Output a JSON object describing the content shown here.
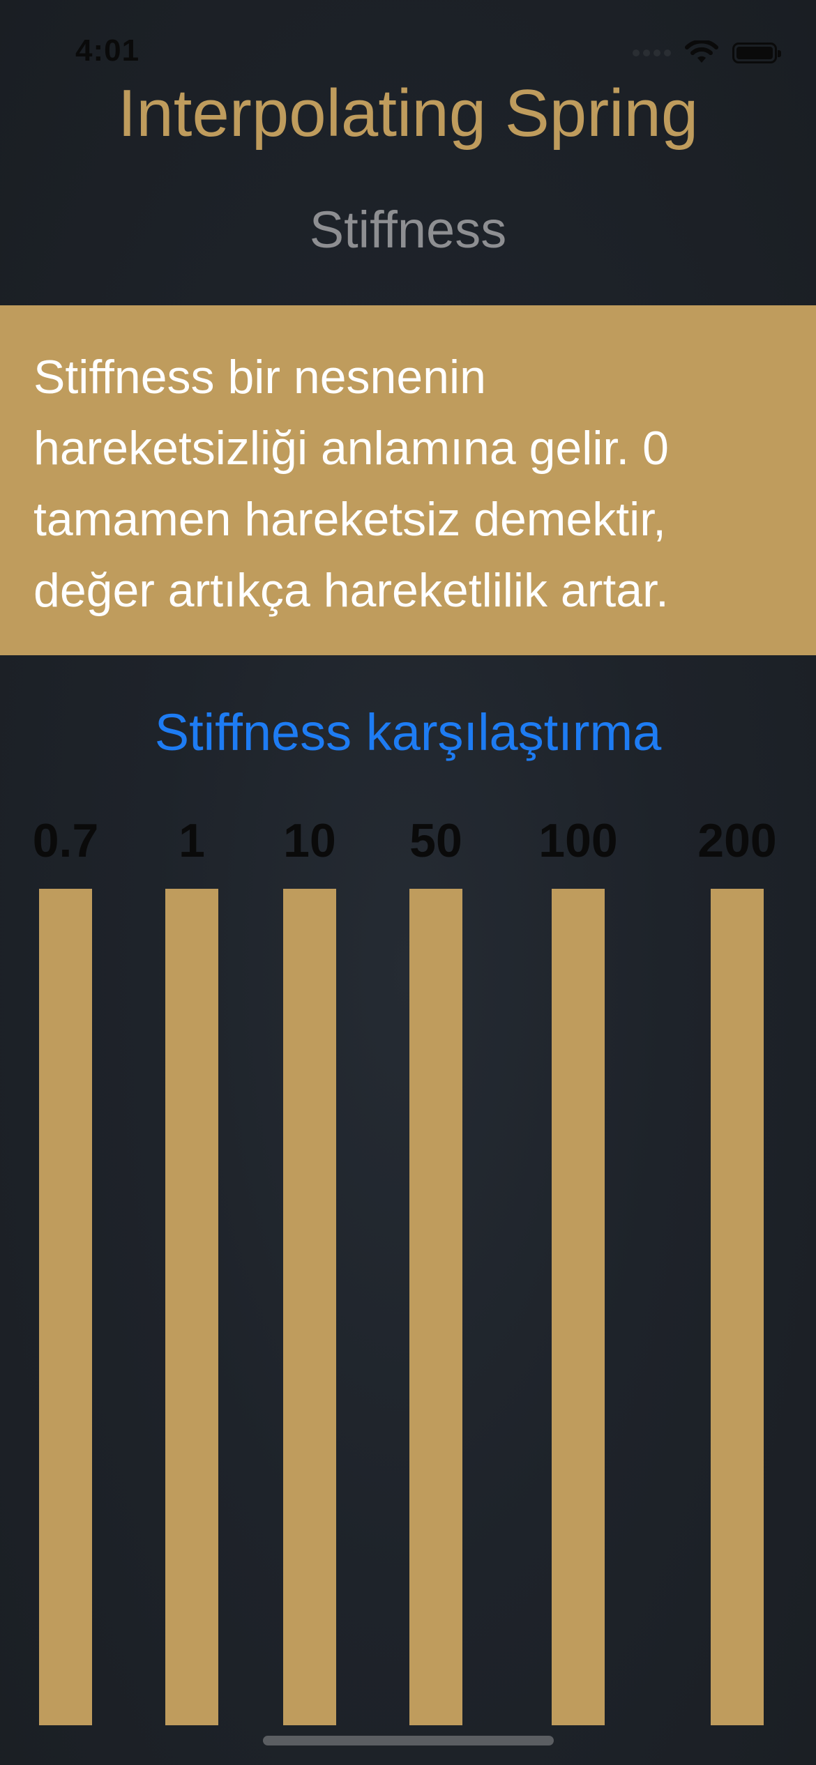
{
  "status_bar": {
    "time": "4:01",
    "icons": [
      "signal-icon",
      "wifi-icon",
      "battery-icon"
    ]
  },
  "nav": {
    "title": "Interpolating Spring"
  },
  "section": {
    "subtitle": "Stiffness"
  },
  "description": {
    "lines": [
      "Stiffness bir nesnenin",
      "hareketsizliği anlamına gelir. 0",
      "tamamen hareketsiz demektir,",
      "değer artıkça hareketlilik artar."
    ]
  },
  "comparison": {
    "title": "Stiffness karşılaştırma",
    "items": [
      {
        "label": "0.7"
      },
      {
        "label": "1"
      },
      {
        "label": "10"
      },
      {
        "label": "50"
      },
      {
        "label": "100"
      },
      {
        "label": "200"
      }
    ]
  },
  "colors": {
    "accent_gold": "#bf9c5d",
    "link_blue": "#1e7cf3",
    "subtitle_gray": "#8e8f92",
    "background": "#1e232a"
  }
}
